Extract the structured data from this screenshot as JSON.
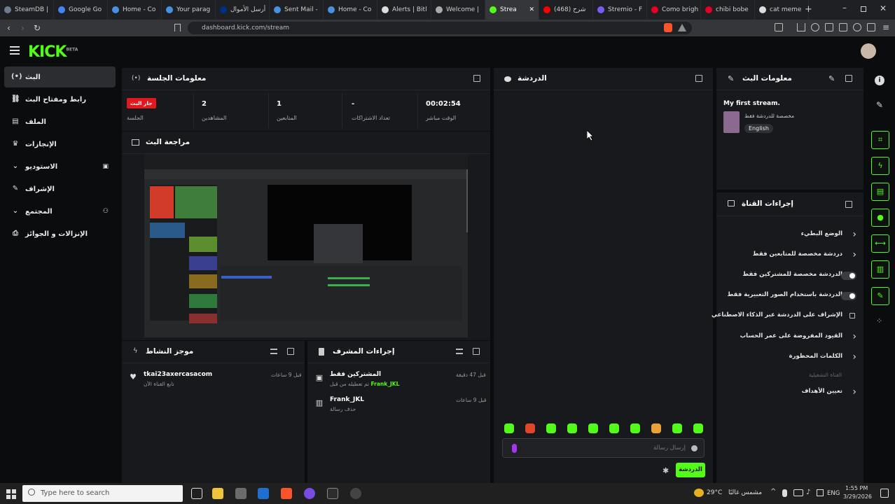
{
  "browser": {
    "tabs": [
      {
        "label": "SteamDB | ",
        "color": "#6b7c8f"
      },
      {
        "label": "Google Go",
        "color": "#4285f4"
      },
      {
        "label": "Home - Co",
        "color": "#4a90e2"
      },
      {
        "label": "Your parag",
        "color": "#4a90e2"
      },
      {
        "label": "أرسل الأموال",
        "color": "#003087"
      },
      {
        "label": "Sent Mail -",
        "color": "#4a90e2"
      },
      {
        "label": "Home - Co",
        "color": "#4a90e2"
      },
      {
        "label": "Alerts | Bitl",
        "color": "#dddddd"
      },
      {
        "label": "Welcome |",
        "color": "#aaaaaa"
      },
      {
        "label": "Strea",
        "color": "#53fc18"
      },
      {
        "label": "شرح (468)",
        "color": "#ff0000"
      },
      {
        "label": "Stremio - F",
        "color": "#7b5bf5"
      },
      {
        "label": "Como brigh",
        "color": "#e60023"
      },
      {
        "label": "chibi bobe",
        "color": "#e60023"
      },
      {
        "label": "cat meme",
        "color": "#dddddd"
      }
    ],
    "url": "dashboard.kick.com/stream"
  },
  "app": {
    "logo": "KICK",
    "logo_badge": "BETA"
  },
  "sidebar": {
    "items": [
      {
        "label": "البث",
        "icon": "(•)"
      },
      {
        "label": "رابط ومفتاح البث",
        "icon": "⛓"
      },
      {
        "label": "الملف",
        "icon": "▤"
      },
      {
        "label": "الإنجازات",
        "icon": "♛"
      },
      {
        "label": "الاستوديو",
        "icon": "⌄"
      },
      {
        "label": "الإشراف",
        "icon": "✎"
      },
      {
        "label": "المجتمع",
        "icon": "⌄"
      },
      {
        "label": "الإنزالات و الجوائز",
        "icon": "⎙"
      }
    ]
  },
  "session": {
    "title": "معلومات الجلسة",
    "stats": [
      {
        "value": "00:02:54",
        "label": "الوقت مباشر"
      },
      {
        "value": "-",
        "label": "تعداد الاشتراكات"
      },
      {
        "value": "1",
        "label": "المتابعين"
      },
      {
        "value": "2",
        "label": "المشاهدين"
      }
    ],
    "live_badge": "جار البث",
    "live_label": "الجلسة"
  },
  "preview": {
    "title": "مراجعة البث"
  },
  "activity": {
    "title": "موجز النشاط",
    "items": [
      {
        "user": "tkai23axercasacom",
        "desc": "تابع القناة الآن",
        "time": "قبل 9 ساعات"
      }
    ]
  },
  "mod_actions": {
    "title": "إجراءات المشرف",
    "items": [
      {
        "title": "المشتركين فقط",
        "desc": "تم تعطيله من قبل",
        "user": "Frank_JKL",
        "time": "قبل 47 دقيقة"
      },
      {
        "title": "Frank_JKL",
        "desc": "حذف رسالة",
        "time": "قبل 9 ساعات"
      }
    ]
  },
  "chat": {
    "title": "الدردشة",
    "input_placeholder": "إرسال رسالة",
    "send_label": "الدردشة"
  },
  "stream_info": {
    "title": "معلومات البث",
    "stream_title": "My first stream.",
    "category": "مخصصة للدردشة فقط",
    "language": "English"
  },
  "channel_actions": {
    "title": "إجراءات القناة",
    "rows": [
      {
        "label": "الوضع البطيء",
        "kind": "chevron"
      },
      {
        "label": "دردشة مخصصة للمتابعين فقط",
        "kind": "chevron"
      },
      {
        "label": "الدردشة مخصصة للمشتركين فقط",
        "kind": "toggle"
      },
      {
        "label": "الدردشة باستخدام الصور التعبيرية فقط",
        "kind": "toggle"
      },
      {
        "label": "الإشراف على الدردشة عبر الذكاء الاصطناعي",
        "kind": "link"
      },
      {
        "label": "القيود المفروضة على عمر الحساب",
        "kind": "chevron"
      },
      {
        "label": "الكلمات المحظورة",
        "kind": "chevron"
      }
    ],
    "section_label": "القناة التشغيلية",
    "goals_label": "تعيين الأهداف"
  },
  "taskbar": {
    "search_placeholder": "Type here to search",
    "weather": "29°C",
    "weather_desc": "مشمس غالبًا",
    "lang": "ENG",
    "time": "1:55 PM",
    "date": "3/29/2026"
  }
}
